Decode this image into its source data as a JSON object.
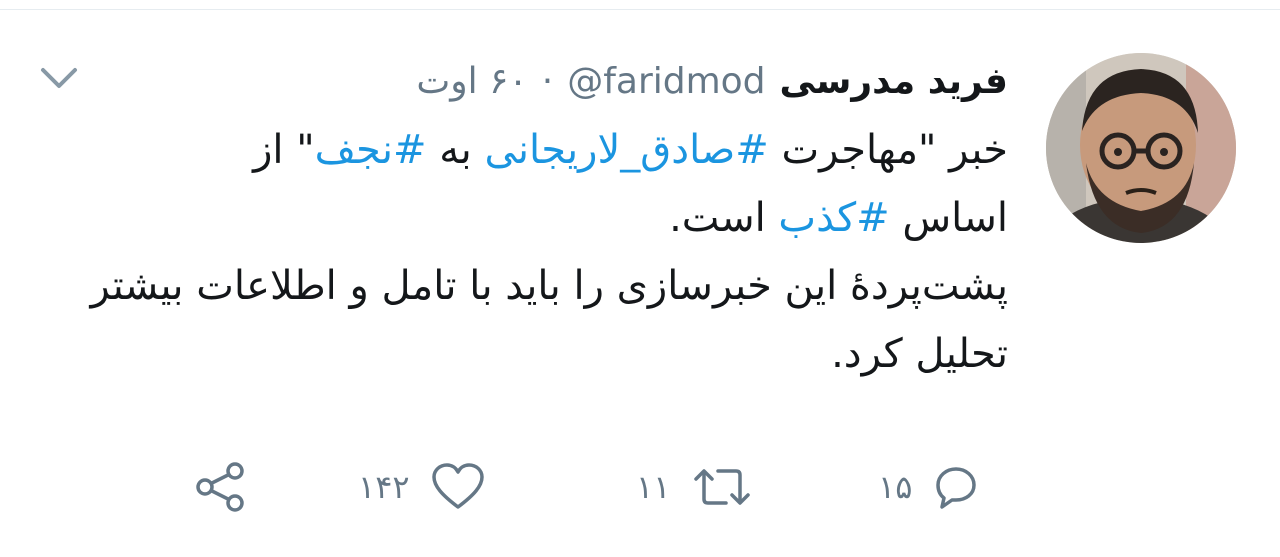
{
  "tweet": {
    "author_name": "فرید مدرسی",
    "handle": "@faridmod",
    "separator": "·",
    "time": "۶۰ اوت",
    "line1": {
      "part1": "خبر \"مهاجرت ",
      "hashtag1": "#صادق_لاریجانی",
      "part2": " به ",
      "hashtag2": "#نجف",
      "part3": "\" از"
    },
    "line2": {
      "part1": "اساس ",
      "hashtag": "#کذب",
      "part2": " است."
    },
    "paragraph2": "پشت‌پردهٔ این خبرسازی را باید با تامل و اطلاعات بیشتر تحلیل کرد."
  },
  "actions": {
    "reply_count": "۱۵",
    "retweet_count": "۱۱",
    "like_count": "۱۴۲"
  },
  "icons": {
    "menu": "chevron-down-icon",
    "reply": "reply-icon",
    "retweet": "retweet-icon",
    "like": "heart-icon",
    "share": "share-icon"
  },
  "colors": {
    "text": "#14171a",
    "secondary": "#657786",
    "hashtag": "#1b95e0",
    "divider": "#e6ecf0"
  }
}
